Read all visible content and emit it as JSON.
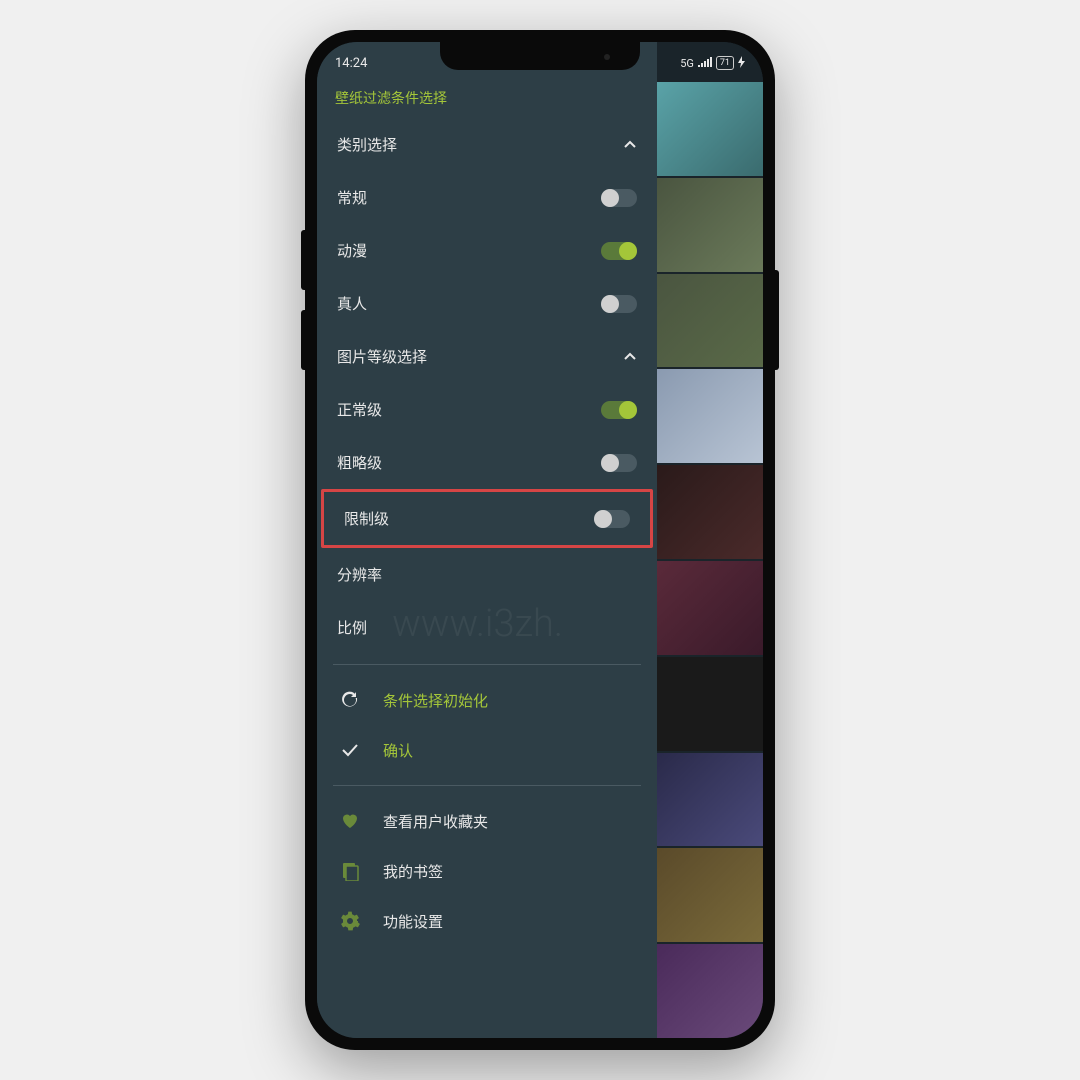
{
  "status": {
    "time": "14:24",
    "network": "5G",
    "battery": "71"
  },
  "drawer": {
    "title": "壁纸过滤条件选择",
    "sections": {
      "category": {
        "label": "类别选择",
        "expanded": true
      },
      "grade": {
        "label": "图片等级选择",
        "expanded": true
      }
    },
    "toggles": {
      "normal_cat": {
        "label": "常规",
        "on": false
      },
      "anime": {
        "label": "动漫",
        "on": true
      },
      "people": {
        "label": "真人",
        "on": false
      },
      "normal_grade": {
        "label": "正常级",
        "on": true
      },
      "sketchy": {
        "label": "粗略级",
        "on": false
      },
      "restricted": {
        "label": "限制级",
        "on": false,
        "highlighted": true
      }
    },
    "rows": {
      "resolution": "分辨率",
      "ratio": "比例"
    },
    "actions": {
      "reset": "条件选择初始化",
      "confirm": "确认",
      "favorites": "查看用户收藏夹",
      "bookmarks": "我的书签",
      "settings": "功能设置"
    }
  },
  "watermark": "www.i3zh."
}
